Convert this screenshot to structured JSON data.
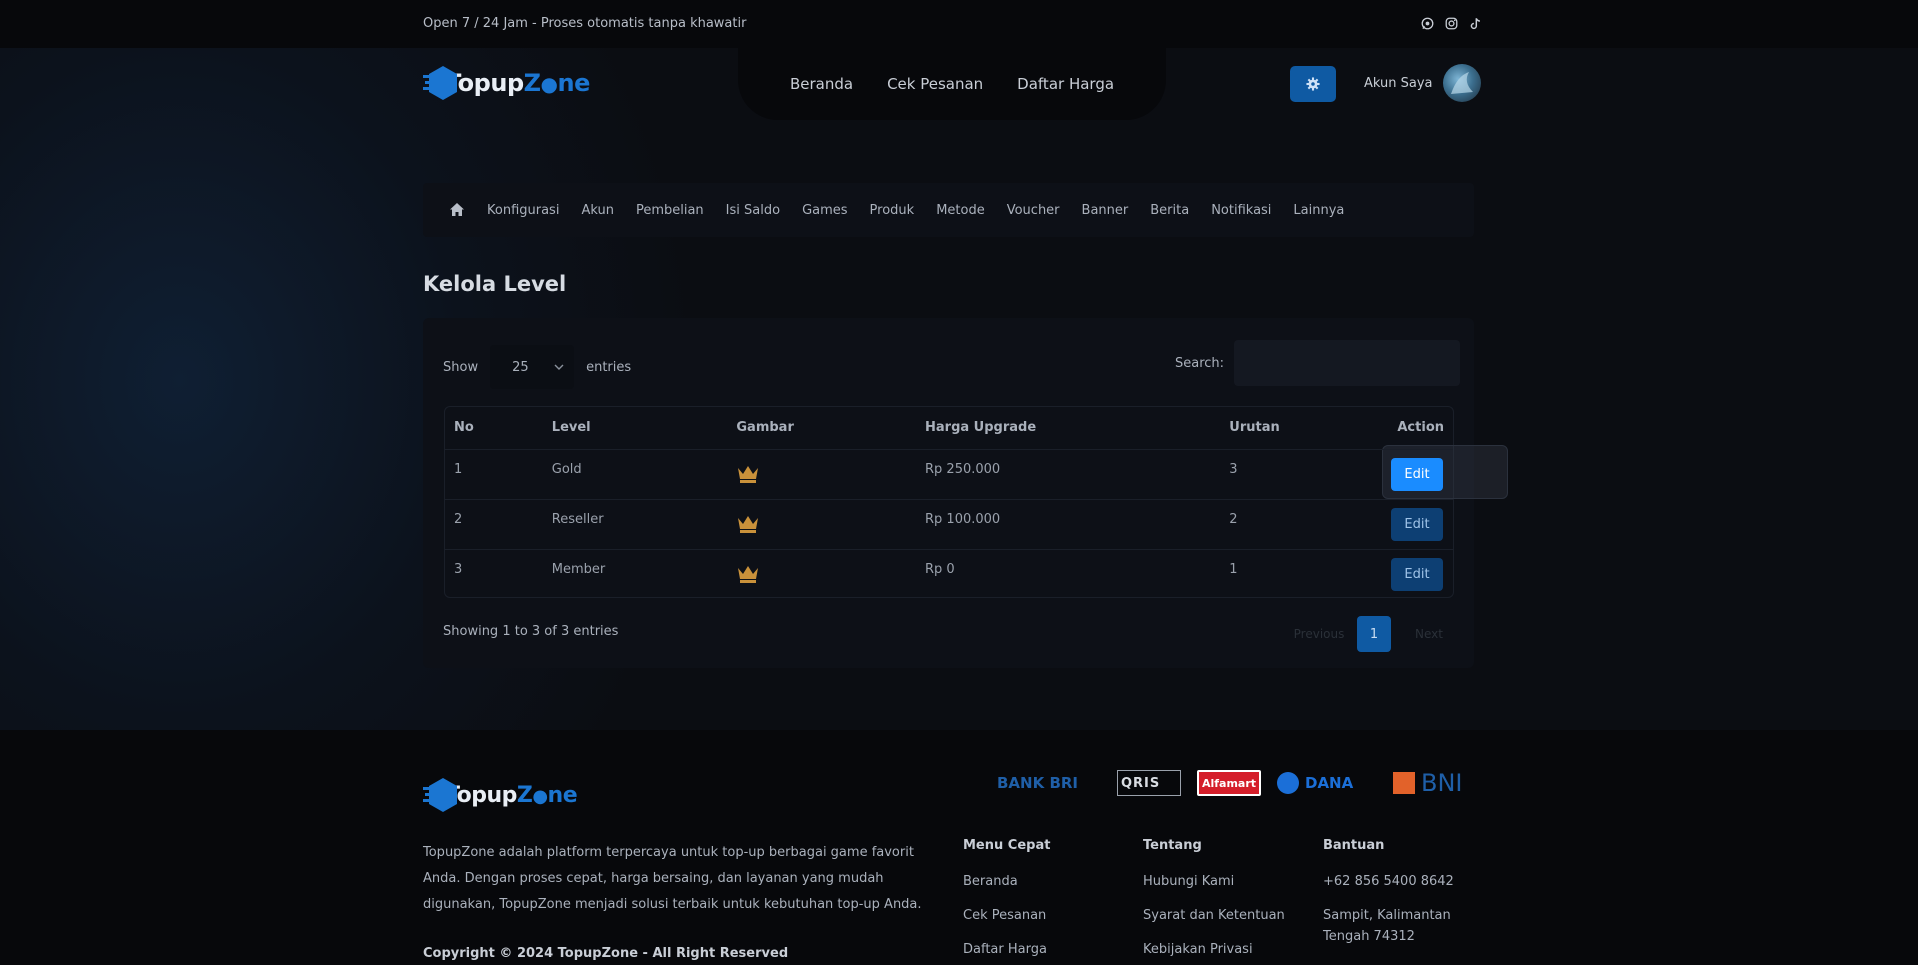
{
  "topbar": {
    "tagline": "Open 7 / 24 Jam - Proses otomatis tanpa khawatir",
    "socials": [
      "whatsapp-icon",
      "instagram-icon",
      "tiktok-icon"
    ]
  },
  "brand": {
    "name_part1": "Topup",
    "name_part2": "Z",
    "name_part3": "ne",
    "accent": "#1b76d2"
  },
  "nav": {
    "items": [
      "Beranda",
      "Cek Pesanan",
      "Daftar Harga"
    ],
    "account_label": "Akun Saya"
  },
  "admin_menu": {
    "items": [
      "Konfigurasi",
      "Akun",
      "Pembelian",
      "Isi Saldo",
      "Games",
      "Produk",
      "Metode",
      "Voucher",
      "Banner",
      "Berita",
      "Notifikasi",
      "Lainnya"
    ]
  },
  "page": {
    "title": "Kelola Level"
  },
  "table_controls": {
    "show_label": "Show",
    "entries_value": "25",
    "entries_label": "entries",
    "search_label": "Search:"
  },
  "table": {
    "columns": [
      "No",
      "Level",
      "Gambar",
      "Harga Upgrade",
      "Urutan",
      "Action"
    ],
    "rows": [
      {
        "no": "1",
        "level": "Gold",
        "price": "Rp 250.000",
        "order": "3",
        "action": "Edit"
      },
      {
        "no": "2",
        "level": "Reseller",
        "price": "Rp 100.000",
        "order": "2",
        "action": "Edit"
      },
      {
        "no": "3",
        "level": "Member",
        "price": "Rp 0",
        "order": "1",
        "action": "Edit"
      }
    ]
  },
  "pagination": {
    "summary": "Showing 1 to 3 of 3 entries",
    "previous": "Previous",
    "current": "1",
    "next": "Next"
  },
  "footer": {
    "about": "TopupZone adalah platform terpercaya untuk top-up berbagai game favorit Anda. Dengan proses cepat, harga bersaing, dan layanan yang mudah digunakan, TopupZone menjadi solusi terbaik untuk kebutuhan top-up Anda.",
    "copyright": "Copyright © 2024 TopupZone - All Right Reserved",
    "payment_logos": {
      "bri": "BANK BRI",
      "qris": "QRIS",
      "alfamart": "Alfamart",
      "dana": "DANA",
      "bni": "BNI"
    },
    "menu_cepat": {
      "title": "Menu Cepat",
      "links": [
        "Beranda",
        "Cek Pesanan",
        "Daftar Harga"
      ]
    },
    "tentang": {
      "title": "Tentang",
      "links": [
        "Hubungi Kami",
        "Syarat dan Ketentuan",
        "Kebijakan Privasi"
      ]
    },
    "bantuan": {
      "title": "Bantuan",
      "phone": "+62 856 5400 8642",
      "address": "Sampit, Kalimantan Tengah 74312"
    }
  },
  "colors": {
    "primary_button": "#1a8cff",
    "muted_button": "#0d3f73",
    "crown": "#c9913a"
  }
}
